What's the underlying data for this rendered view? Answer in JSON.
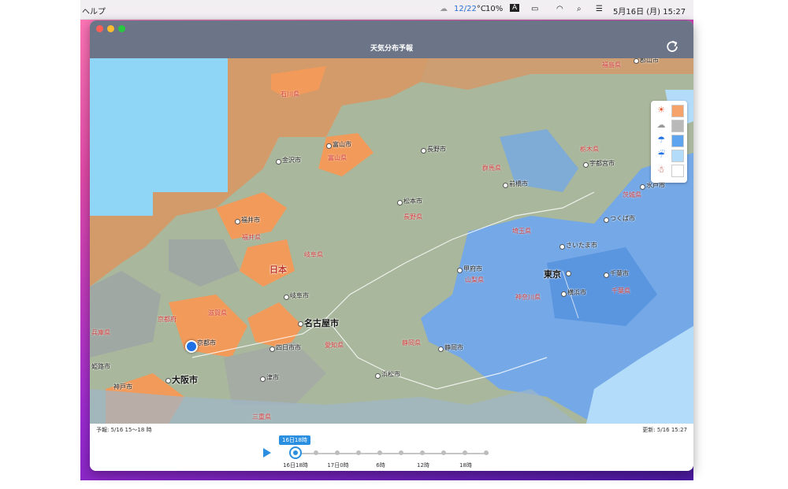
{
  "menubar": {
    "help_menu": "ヘルプ",
    "weather_lo_hi": "12/22",
    "weather_unit": "°C",
    "humidity": "10%",
    "input_mode": "A",
    "datetime": "5月16日 (月)  15:27"
  },
  "window": {
    "title": "天気分布予報"
  },
  "map": {
    "country_label": "日本",
    "big_cities": [
      "東京",
      "名古屋市",
      "大阪市"
    ],
    "cities": [
      "富山市",
      "金沢市",
      "長野市",
      "福井市",
      "松本市",
      "前橋市",
      "宇都宮市",
      "水戸市",
      "つくば市",
      "さいたま市",
      "甲府市",
      "千葉市",
      "横浜市",
      "岐阜市",
      "京都市",
      "四日市市",
      "静岡市",
      "浜松市",
      "津市",
      "姫路市",
      "神戸市",
      "郡山市"
    ],
    "prefectures": [
      "福島県",
      "石川県",
      "富山県",
      "栃木県",
      "群馬県",
      "茨城県",
      "福井県",
      "長野県",
      "埼玉県",
      "岐阜県",
      "山梨県",
      "神奈川県",
      "千葉県",
      "滋賀県",
      "京都府",
      "愛知県",
      "静岡県",
      "兵庫県",
      "三重県"
    ]
  },
  "legend": {
    "items": [
      {
        "icon": "sun-icon",
        "glyph": "☀",
        "color": "#f5a36b"
      },
      {
        "icon": "cloud-icon",
        "glyph": "☁",
        "color": "#b9b9b9"
      },
      {
        "icon": "umbrella-icon",
        "glyph": "☂",
        "color": "#5ea4ef"
      },
      {
        "icon": "umbrella-snow-icon",
        "glyph": "☔",
        "color": "#b3dcfb"
      },
      {
        "icon": "snowman-icon",
        "glyph": "☃",
        "color": "#ffffff"
      }
    ]
  },
  "footer": {
    "forecast": "予報: 5/16 15〜18 時",
    "updated": "更新: 5/16 15:27",
    "current_bubble": "16日18時",
    "timeline": [
      "16日18時",
      "17日0時",
      "6時",
      "12時",
      "18時"
    ],
    "selected_step": 0,
    "step_count": 10
  },
  "colors": {
    "accent": "#2a8fe0",
    "sunny": "#f5a36b",
    "cloudy": "#b9b9b9",
    "rain": "#5ea4ef",
    "light_rain": "#b3dcfb"
  }
}
